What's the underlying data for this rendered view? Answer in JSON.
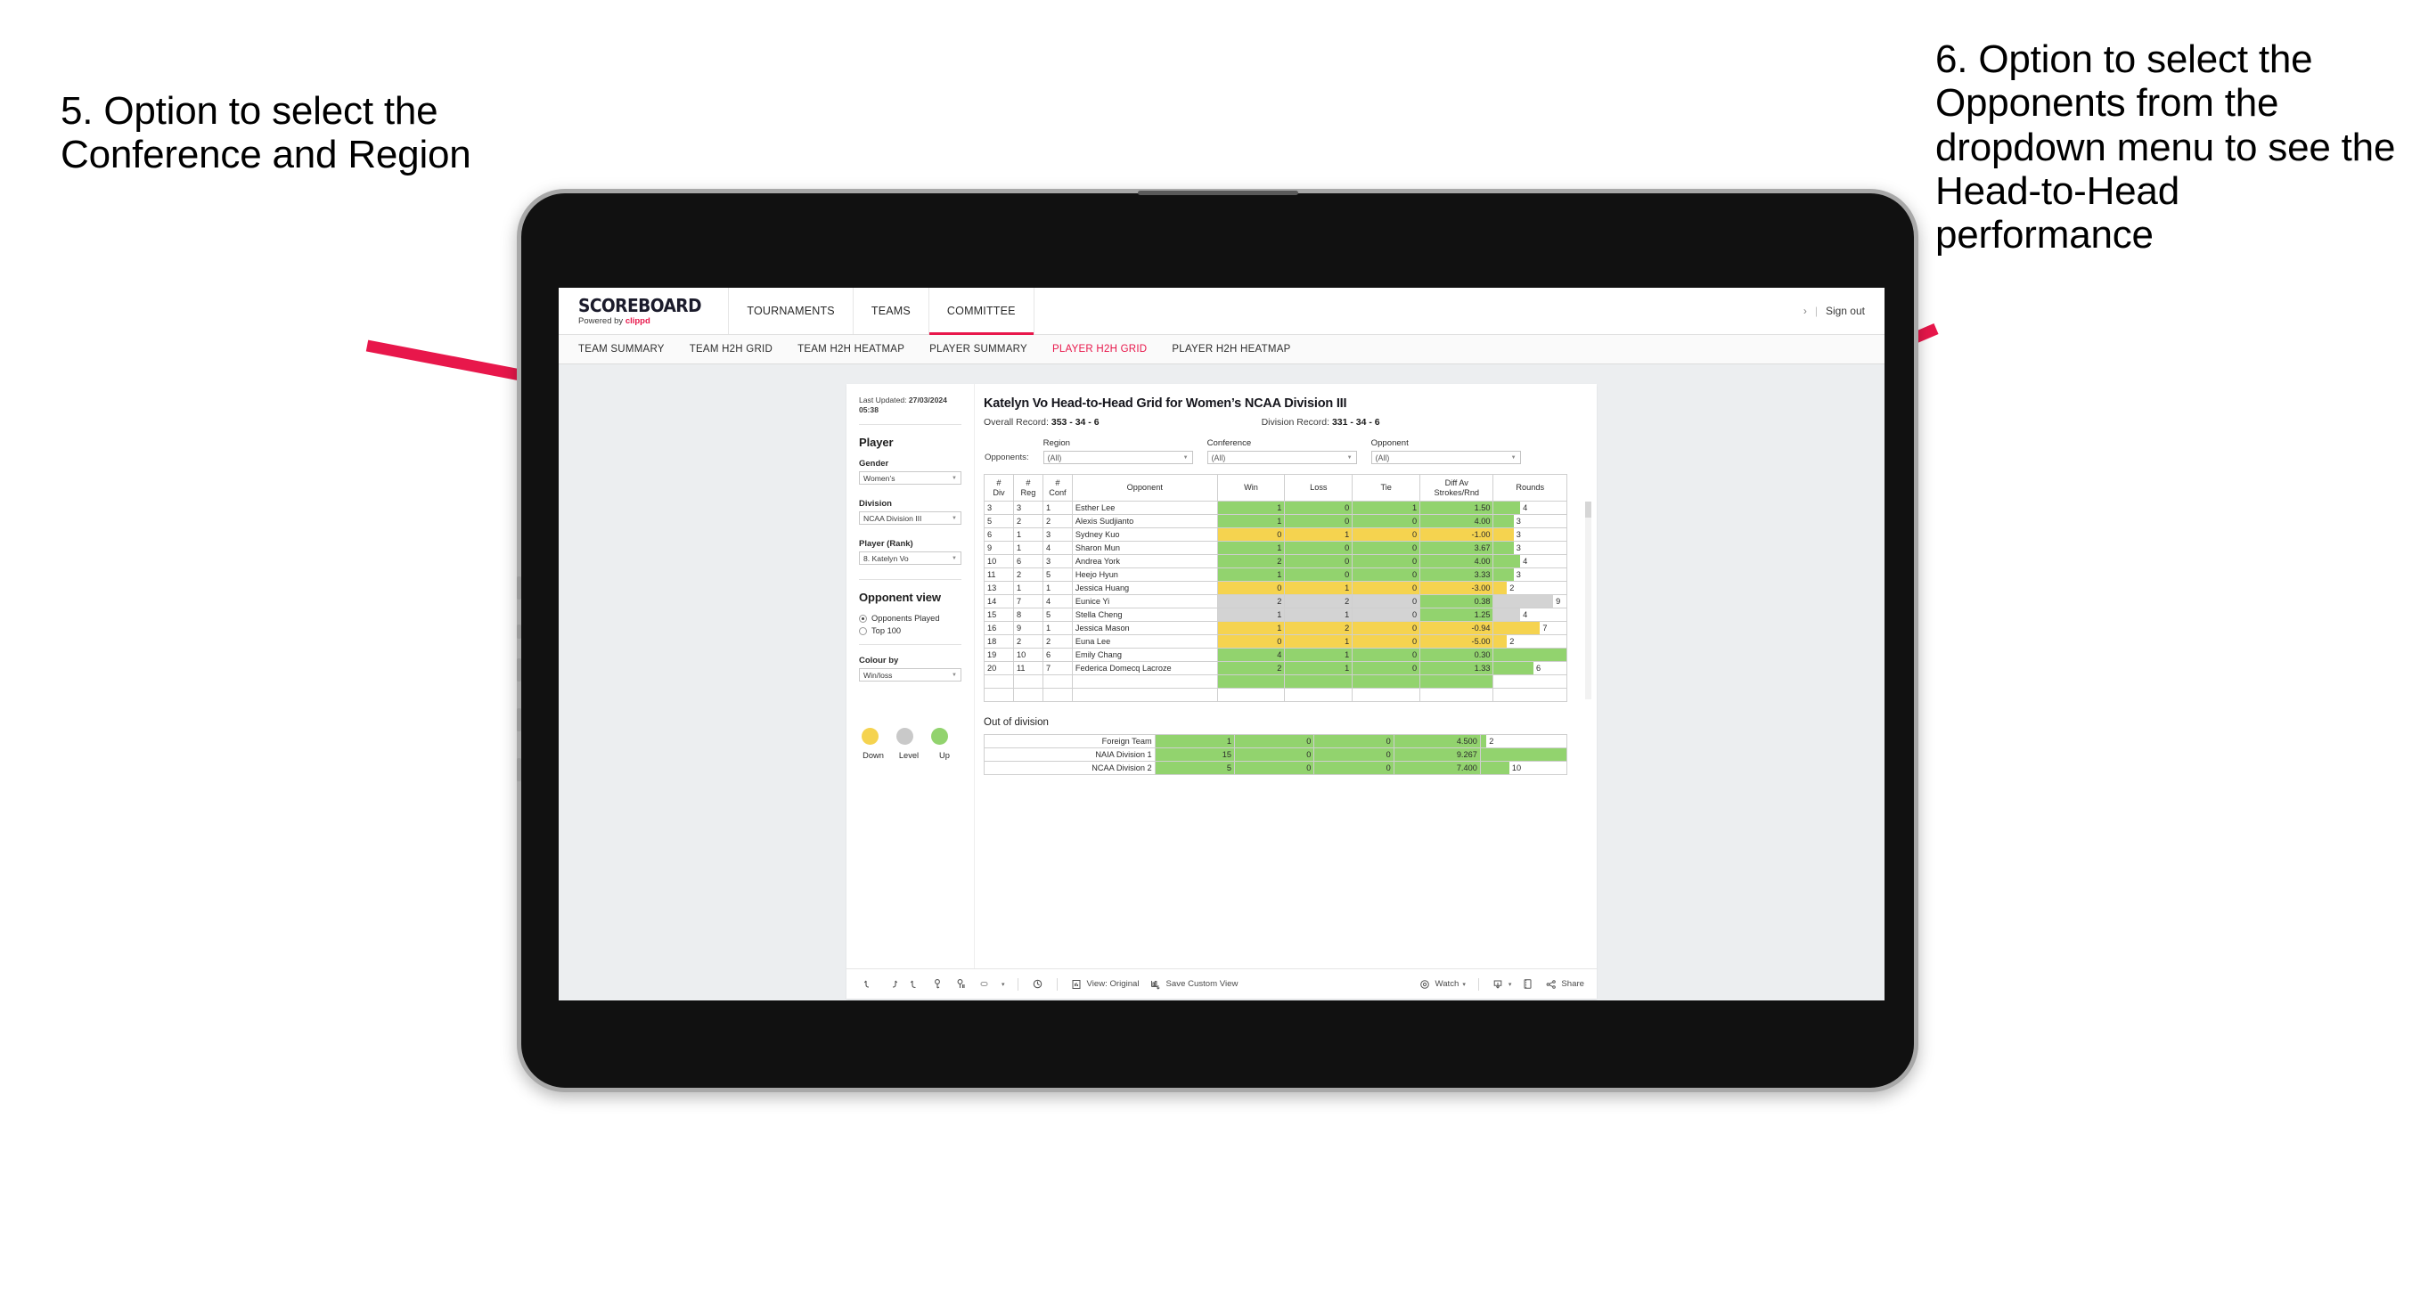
{
  "annotations": {
    "left": "5. Option to select the Conference and Region",
    "right": "6. Option to select the Opponents from the dropdown menu to see the Head-to-Head performance"
  },
  "header": {
    "brand_name": "SCOREBOARD",
    "brand_sub_prefix": "Powered by ",
    "brand_sub_mark": "clippd",
    "nav": [
      {
        "label": "TOURNAMENTS",
        "active": false
      },
      {
        "label": "TEAMS",
        "active": false
      },
      {
        "label": "COMMITTEE",
        "active": true
      }
    ],
    "chevron": "›",
    "separator": "|",
    "sign_out": "Sign out"
  },
  "subnav": [
    {
      "label": "TEAM SUMMARY",
      "active": false
    },
    {
      "label": "TEAM H2H GRID",
      "active": false
    },
    {
      "label": "TEAM H2H HEATMAP",
      "active": false
    },
    {
      "label": "PLAYER SUMMARY",
      "active": false
    },
    {
      "label": "PLAYER H2H GRID",
      "active": true
    },
    {
      "label": "PLAYER H2H HEATMAP",
      "active": false
    }
  ],
  "sidebar": {
    "last_updated_label": "Last Updated: ",
    "last_updated_value": "27/03/2024",
    "last_updated_time": "05:38",
    "player_heading": "Player",
    "fields": [
      {
        "label": "Gender",
        "value": "Women’s"
      },
      {
        "label": "Division",
        "value": "NCAA Division III"
      },
      {
        "label": "Player (Rank)",
        "value": "8. Katelyn Vo"
      }
    ],
    "opponent_view_heading": "Opponent view",
    "opponent_view_options": [
      {
        "label": "Opponents Played",
        "selected": true
      },
      {
        "label": "Top 100",
        "selected": false
      }
    ],
    "colour_by_label": "Colour by",
    "colour_by_value": "Win/loss",
    "legend": [
      {
        "label": "Down",
        "color": "#f5d34f"
      },
      {
        "label": "Level",
        "color": "#c9c9c9"
      },
      {
        "label": "Up",
        "color": "#92d36e"
      }
    ]
  },
  "main": {
    "title": "Katelyn Vo Head-to-Head Grid for Women’s NCAA Division III",
    "overall_record_label": "Overall Record: ",
    "overall_record_value": "353 -  34 - 6",
    "division_record_label": "Division Record: ",
    "division_record_value": "331 -  34 - 6",
    "opponents_label": "Opponents:",
    "filters": [
      {
        "label": "Region",
        "value": "(All)"
      },
      {
        "label": "Conference",
        "value": "(All)"
      },
      {
        "label": "Opponent",
        "value": "(All)"
      }
    ],
    "out_of_division_title": "Out of division"
  },
  "toolbar": {
    "view_label": "View: Original",
    "save_label": "Save Custom View",
    "watch_label": "Watch",
    "share_label": "Share",
    "caret": "▾"
  },
  "chart_data": {
    "type": "table",
    "title": "Katelyn Vo Head-to-Head Grid for Women’s NCAA Division III",
    "columns": [
      "# Div",
      "# Reg",
      "# Conf",
      "Opponent",
      "Win",
      "Loss",
      "Tie",
      "Diff Av Strokes/Rnd",
      "Rounds"
    ],
    "column_headers_multiline": [
      {
        "l1": "#",
        "l2": "Div"
      },
      {
        "l1": "#",
        "l2": "Reg"
      },
      {
        "l1": "#",
        "l2": "Conf"
      },
      {
        "l1": "Opponent",
        "l2": ""
      },
      {
        "l1": "Win",
        "l2": ""
      },
      {
        "l1": "Loss",
        "l2": ""
      },
      {
        "l1": "Tie",
        "l2": ""
      },
      {
        "l1": "Diff Av",
        "l2": "Strokes/Rnd"
      },
      {
        "l1": "Rounds",
        "l2": ""
      }
    ],
    "rounds_axis_max": 11,
    "rows": [
      {
        "div": "3",
        "reg": "3",
        "conf": "1",
        "opponent": "Esther Lee",
        "win": "1",
        "loss": "0",
        "tie": "1",
        "diff": "1.50",
        "rounds": "4",
        "status": "g"
      },
      {
        "div": "5",
        "reg": "2",
        "conf": "2",
        "opponent": "Alexis Sudjianto",
        "win": "1",
        "loss": "0",
        "tie": "0",
        "diff": "4.00",
        "rounds": "3",
        "status": "g"
      },
      {
        "div": "6",
        "reg": "1",
        "conf": "3",
        "opponent": "Sydney Kuo",
        "win": "0",
        "loss": "1",
        "tie": "0",
        "diff": "-1.00",
        "rounds": "3",
        "status": "y"
      },
      {
        "div": "9",
        "reg": "1",
        "conf": "4",
        "opponent": "Sharon Mun",
        "win": "1",
        "loss": "0",
        "tie": "0",
        "diff": "3.67",
        "rounds": "3",
        "status": "g"
      },
      {
        "div": "10",
        "reg": "6",
        "conf": "3",
        "opponent": "Andrea York",
        "win": "2",
        "loss": "0",
        "tie": "0",
        "diff": "4.00",
        "rounds": "4",
        "status": "g"
      },
      {
        "div": "11",
        "reg": "2",
        "conf": "5",
        "opponent": "Heejo Hyun",
        "win": "1",
        "loss": "0",
        "tie": "0",
        "diff": "3.33",
        "rounds": "3",
        "status": "g"
      },
      {
        "div": "13",
        "reg": "1",
        "conf": "1",
        "opponent": "Jessica Huang",
        "win": "0",
        "loss": "1",
        "tie": "0",
        "diff": "-3.00",
        "rounds": "2",
        "status": "y"
      },
      {
        "div": "14",
        "reg": "7",
        "conf": "4",
        "opponent": "Eunice Yi",
        "win": "2",
        "loss": "2",
        "tie": "0",
        "diff": "0.38",
        "rounds": "9",
        "status": "n",
        "diff_status": "g"
      },
      {
        "div": "15",
        "reg": "8",
        "conf": "5",
        "opponent": "Stella Cheng",
        "win": "1",
        "loss": "1",
        "tie": "0",
        "diff": "1.25",
        "rounds": "4",
        "status": "n",
        "diff_status": "g"
      },
      {
        "div": "16",
        "reg": "9",
        "conf": "1",
        "opponent": "Jessica Mason",
        "win": "1",
        "loss": "2",
        "tie": "0",
        "diff": "-0.94",
        "rounds": "7",
        "status": "y"
      },
      {
        "div": "18",
        "reg": "2",
        "conf": "2",
        "opponent": "Euna Lee",
        "win": "0",
        "loss": "1",
        "tie": "0",
        "diff": "-5.00",
        "rounds": "2",
        "status": "y"
      },
      {
        "div": "19",
        "reg": "10",
        "conf": "6",
        "opponent": "Emily Chang",
        "win": "4",
        "loss": "1",
        "tie": "0",
        "diff": "0.30",
        "rounds": "11",
        "status": "g"
      },
      {
        "div": "20",
        "reg": "11",
        "conf": "7",
        "opponent": "Federica Domecq Lacroze",
        "win": "2",
        "loss": "1",
        "tie": "0",
        "diff": "1.33",
        "rounds": "6",
        "status": "g"
      }
    ],
    "out_of_division": {
      "rounds_axis_max": 30,
      "rows": [
        {
          "label": "Foreign Team",
          "win": "1",
          "loss": "0",
          "tie": "0",
          "diff": "4.500",
          "rounds": "2",
          "status": "g"
        },
        {
          "label": "NAIA Division 1",
          "win": "15",
          "loss": "0",
          "tie": "0",
          "diff": "9.267",
          "rounds": "30",
          "status": "g"
        },
        {
          "label": "NCAA Division 2",
          "win": "5",
          "loss": "0",
          "tie": "0",
          "diff": "7.400",
          "rounds": "10",
          "status": "g"
        }
      ]
    }
  }
}
